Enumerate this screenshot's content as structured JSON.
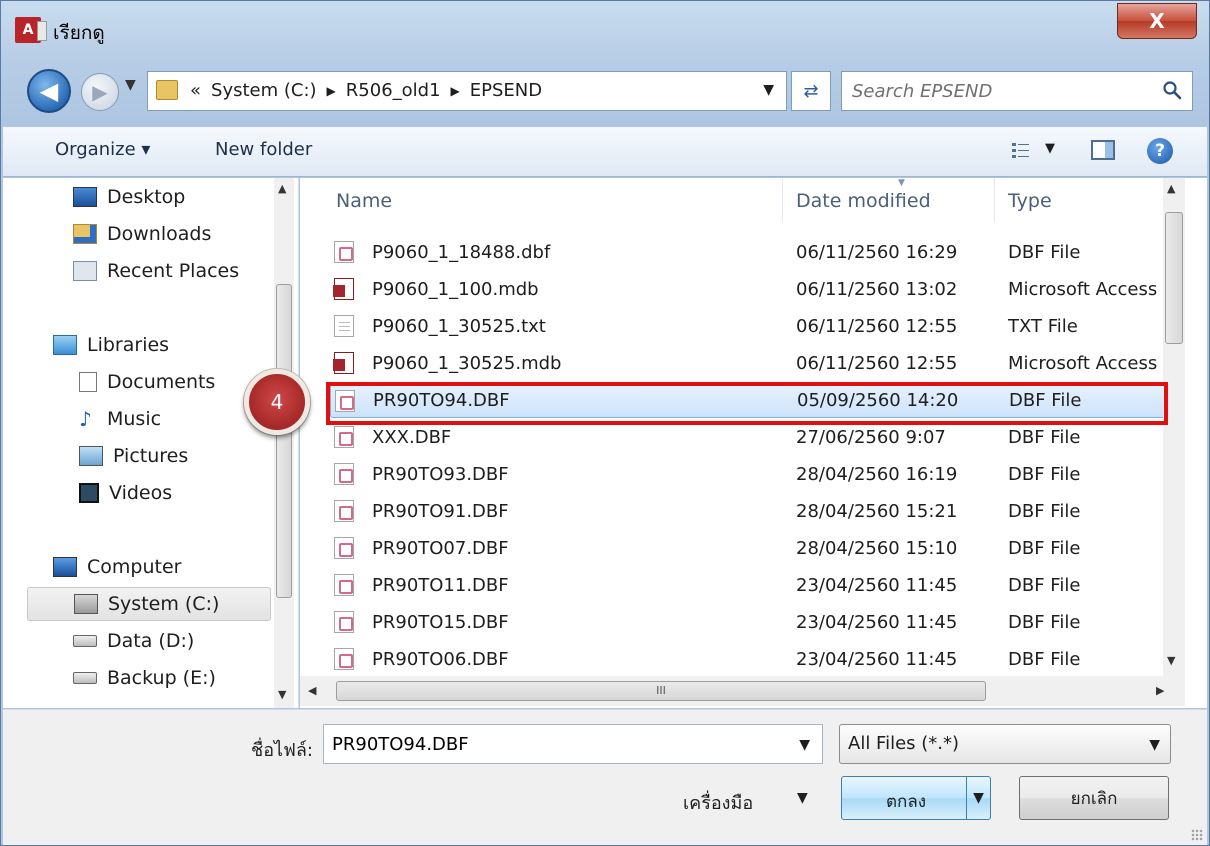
{
  "window": {
    "title": "เรียกดู",
    "app_icon_text": "A",
    "close_label": "X"
  },
  "nav": {
    "breadcrumbs": [
      "«",
      "System (C:)",
      "R506_old1",
      "EPSEND"
    ],
    "search_placeholder": "Search EPSEND"
  },
  "toolbar": {
    "organize_label": "Organize ▾",
    "new_folder_label": "New folder",
    "help_label": "?"
  },
  "sidebar": {
    "items": [
      {
        "label": "Desktop",
        "icon": "desktop-icon"
      },
      {
        "label": "Downloads",
        "icon": "downloads-icon"
      },
      {
        "label": "Recent Places",
        "icon": "recent-places-icon"
      },
      {
        "label": "Libraries",
        "icon": "libraries-icon"
      },
      {
        "label": "Documents",
        "icon": "documents-icon"
      },
      {
        "label": "Music",
        "icon": "music-icon"
      },
      {
        "label": "Pictures",
        "icon": "pictures-icon"
      },
      {
        "label": "Videos",
        "icon": "videos-icon"
      },
      {
        "label": "Computer",
        "icon": "computer-icon"
      },
      {
        "label": "System (C:)",
        "icon": "system-drive-icon"
      },
      {
        "label": "Data (D:)",
        "icon": "drive-icon"
      },
      {
        "label": "Backup (E:)",
        "icon": "drive-icon"
      }
    ]
  },
  "file_list": {
    "columns": [
      "Name",
      "Date modified",
      "Type"
    ],
    "rows": [
      {
        "name": "P9060_1_18488.dbf",
        "date": "06/11/2560 16:29",
        "type": "DBF File",
        "icon": "dbf"
      },
      {
        "name": "P9060_1_100.mdb",
        "date": "06/11/2560 13:02",
        "type": "Microsoft Access",
        "icon": "mdb"
      },
      {
        "name": "P9060_1_30525.txt",
        "date": "06/11/2560 12:55",
        "type": "TXT File",
        "icon": "txt"
      },
      {
        "name": "P9060_1_30525.mdb",
        "date": "06/11/2560 12:55",
        "type": "Microsoft Access",
        "icon": "mdb"
      },
      {
        "name": "PR90TO94.DBF",
        "date": "05/09/2560 14:20",
        "type": "DBF File",
        "icon": "dbf",
        "selected": true
      },
      {
        "name": "XXX.DBF",
        "date": "27/06/2560 9:07",
        "type": "DBF File",
        "icon": "dbf"
      },
      {
        "name": "PR90TO93.DBF",
        "date": "28/04/2560 16:19",
        "type": "DBF File",
        "icon": "dbf"
      },
      {
        "name": "PR90TO91.DBF",
        "date": "28/04/2560 15:21",
        "type": "DBF File",
        "icon": "dbf"
      },
      {
        "name": "PR90TO07.DBF",
        "date": "28/04/2560 15:10",
        "type": "DBF File",
        "icon": "dbf"
      },
      {
        "name": "PR90TO11.DBF",
        "date": "23/04/2560 11:45",
        "type": "DBF File",
        "icon": "dbf"
      },
      {
        "name": "PR90TO15.DBF",
        "date": "23/04/2560 11:45",
        "type": "DBF File",
        "icon": "dbf"
      },
      {
        "name": "PR90TO06.DBF",
        "date": "23/04/2560 11:45",
        "type": "DBF File",
        "icon": "dbf"
      }
    ],
    "hscroll_grip": "III"
  },
  "annotation": {
    "step_number": "4",
    "highlight_color": "#e01010"
  },
  "footer": {
    "filename_label": "ชื่อไฟล์:",
    "filename_value": "PR90TO94.DBF",
    "filter_value": "All Files (*.*)",
    "tools_label": "เครื่องมือ",
    "ok_label": "ตกลง",
    "cancel_label": "ยกเลิก"
  }
}
